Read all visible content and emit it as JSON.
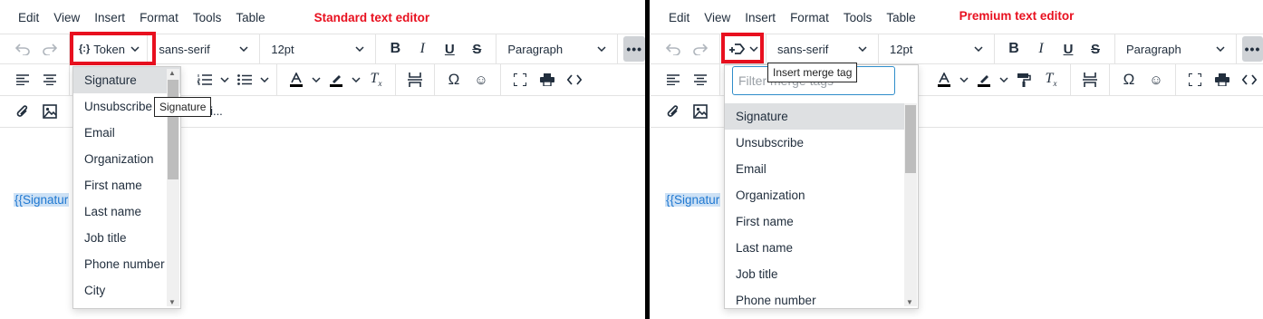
{
  "menus": [
    "Edit",
    "View",
    "Insert",
    "Format",
    "Tools",
    "Table"
  ],
  "standard": {
    "label": "Standard text editor",
    "token_button": "Token",
    "font": "sans-serif",
    "size": "12pt",
    "block": "Paragraph",
    "tooltip": "Signature",
    "partial_text": "e Li...",
    "editor_token": "{{Signatur",
    "items": [
      "Signature",
      "Unsubscribe",
      "Email",
      "Organization",
      "First name",
      "Last name",
      "Job title",
      "Phone number",
      "City"
    ]
  },
  "premium": {
    "label": "Premium text editor",
    "font": "sans-serif",
    "size": "12pt",
    "block": "Paragraph",
    "tooltip": "Insert merge tag",
    "filter_placeholder": "Filter merge tags",
    "editor_token": "{{Signatur",
    "items": [
      "Signature",
      "Unsubscribe",
      "Email",
      "Organization",
      "First name",
      "Last name",
      "Job title",
      "Phone number"
    ]
  },
  "colors": {
    "highlight": "#e8101f",
    "link": "#1f78d1",
    "token_bg": "#cde1f5"
  }
}
